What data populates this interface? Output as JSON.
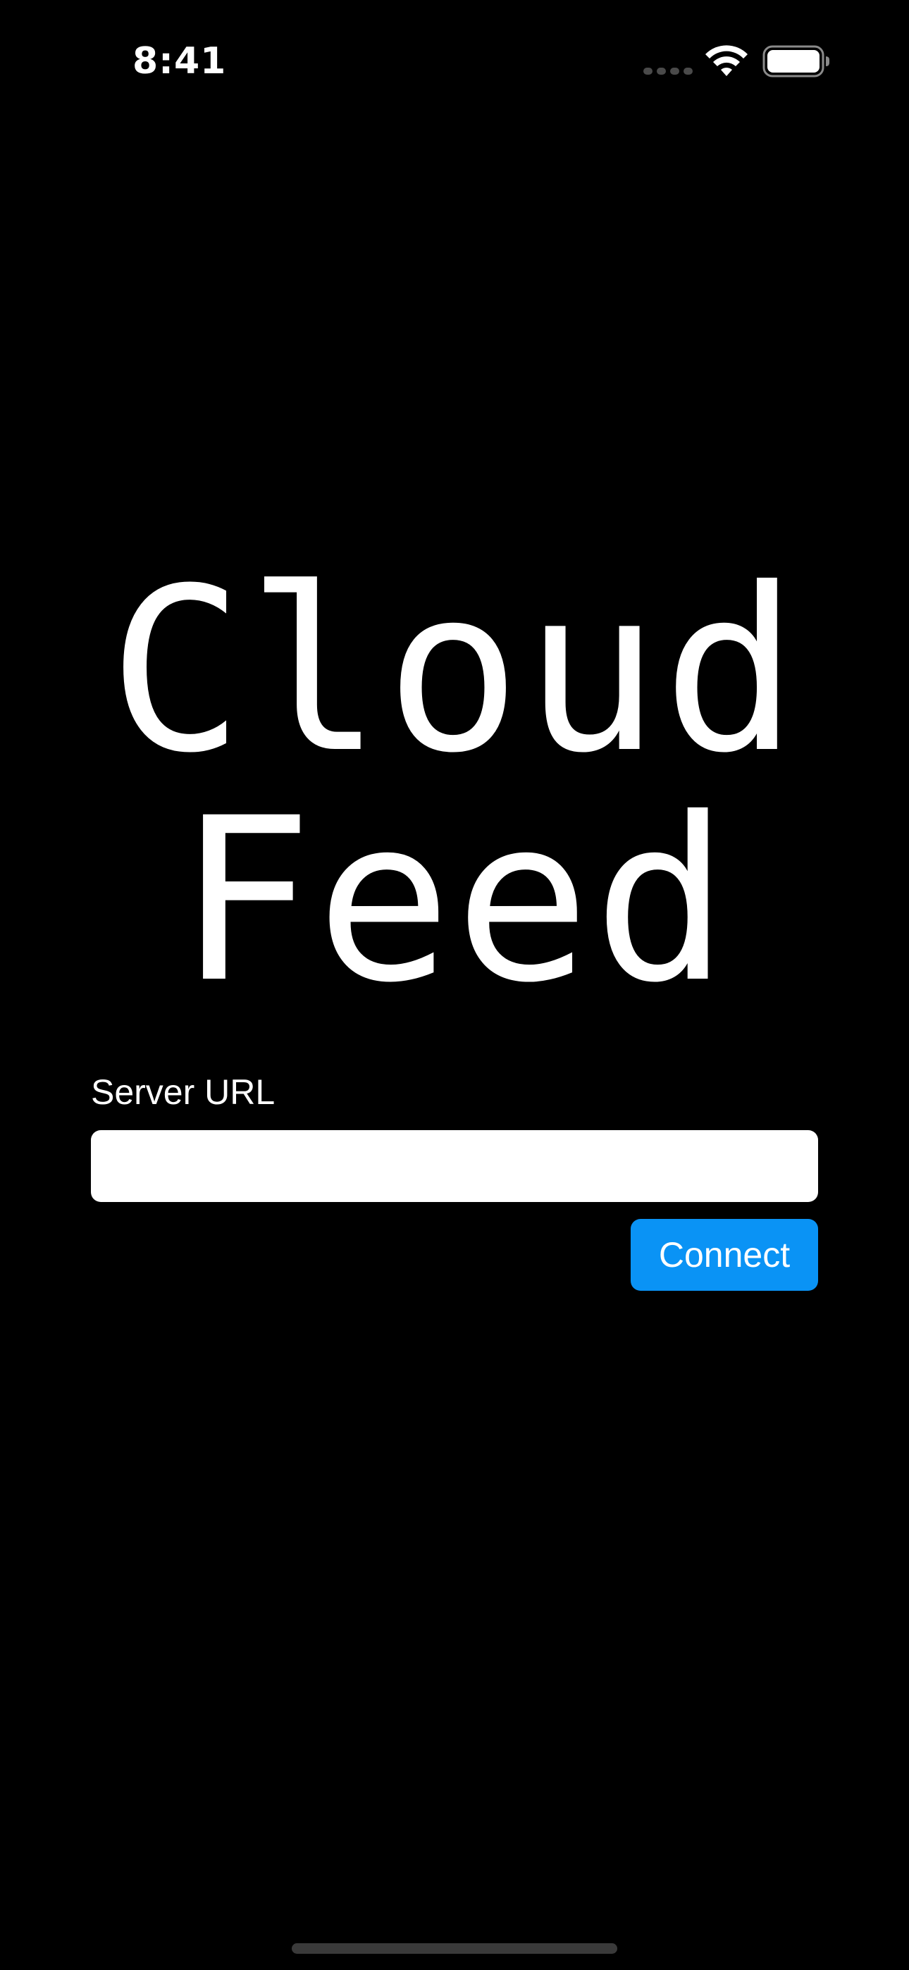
{
  "status_bar": {
    "time": "8:41",
    "icons": [
      "cellular-signal-icon",
      "wifi-icon",
      "battery-icon"
    ]
  },
  "app": {
    "title_line1": "Cloud",
    "title_line2": "Feed"
  },
  "form": {
    "server_url_label": "Server URL",
    "server_url_value": "",
    "server_url_placeholder": "",
    "connect_label": "Connect"
  },
  "colors": {
    "background": "#000000",
    "text": "#ffffff",
    "accent": "#0a93f5",
    "input_background": "#ffffff"
  }
}
